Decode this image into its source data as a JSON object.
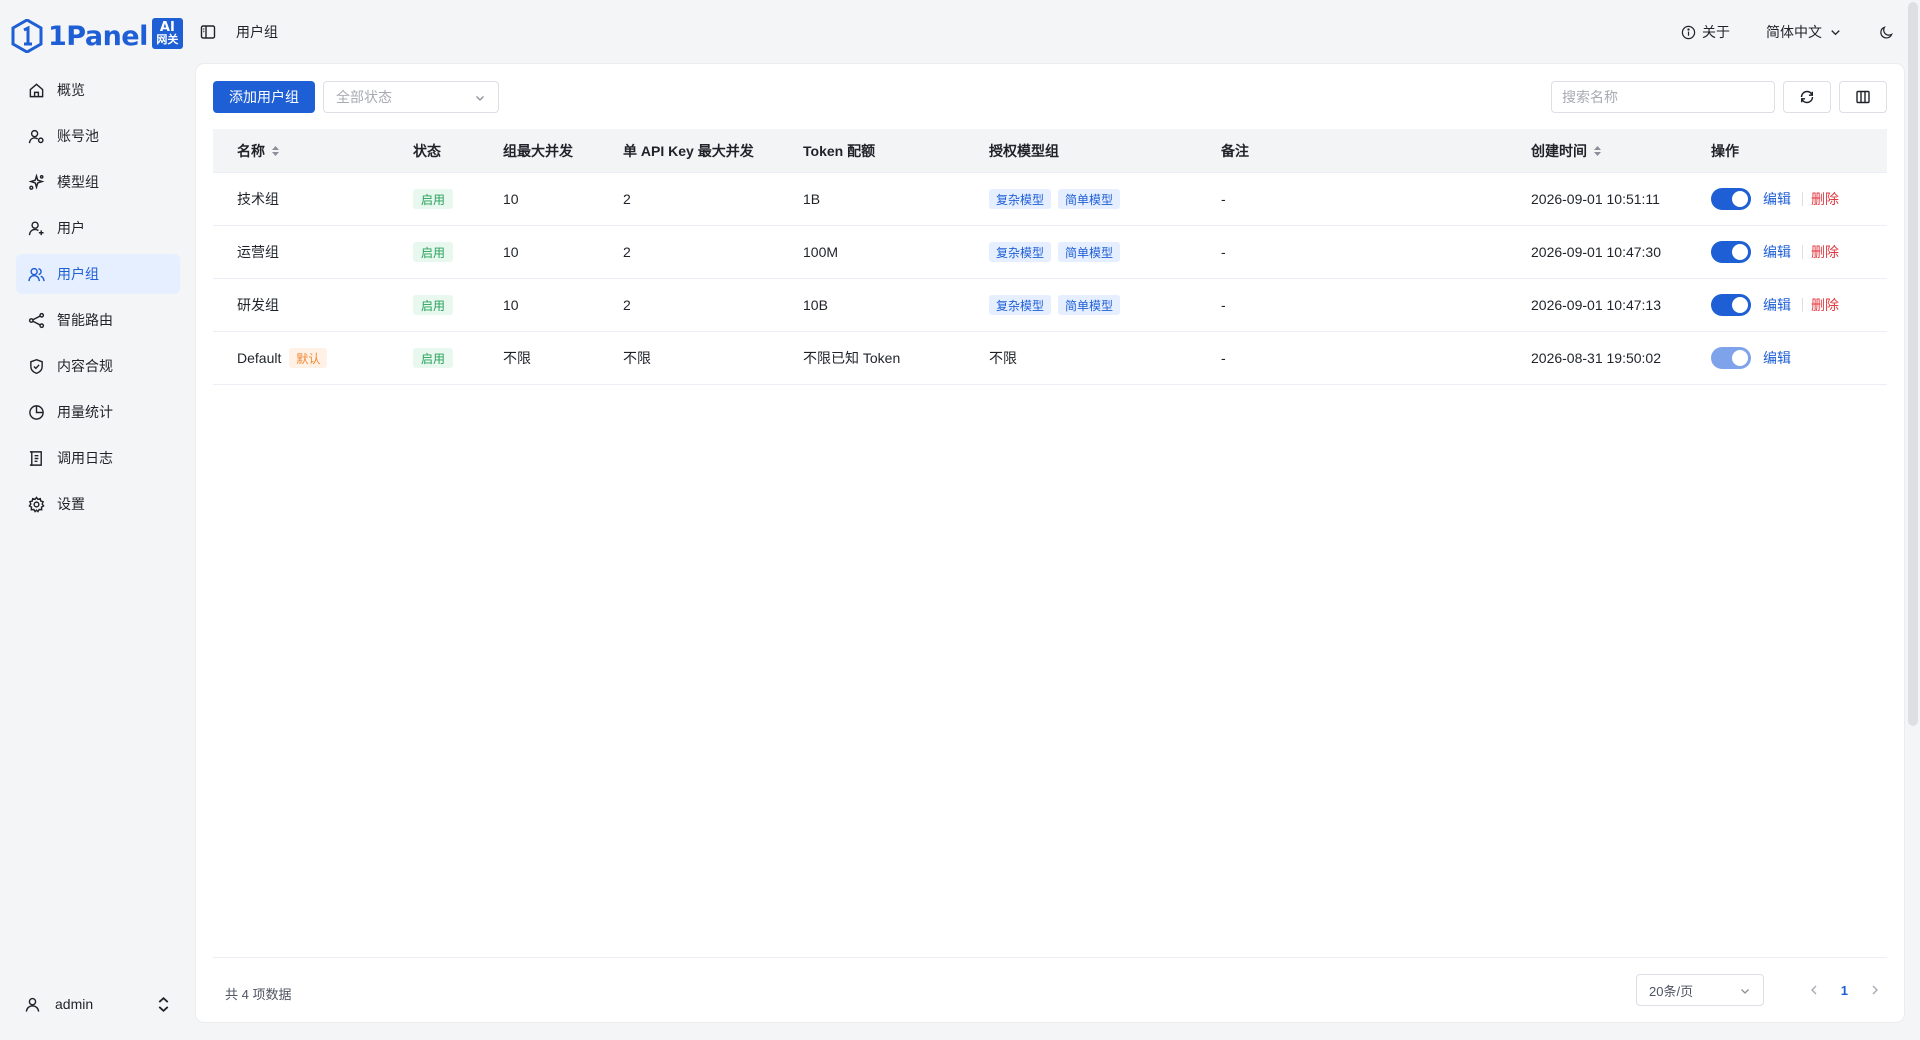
{
  "brand": {
    "name": "1Panel",
    "badge_top": "AI",
    "badge_bottom": "网关"
  },
  "sidebar": {
    "items": [
      {
        "label": "概览",
        "icon": "home-icon",
        "active": false
      },
      {
        "label": "账号池",
        "icon": "account-pool-icon",
        "active": false
      },
      {
        "label": "模型组",
        "icon": "model-group-icon",
        "active": false
      },
      {
        "label": "用户",
        "icon": "user-add-icon",
        "active": false
      },
      {
        "label": "用户组",
        "icon": "users-icon",
        "active": true
      },
      {
        "label": "智能路由",
        "icon": "route-icon",
        "active": false
      },
      {
        "label": "内容合规",
        "icon": "shield-icon",
        "active": false
      },
      {
        "label": "用量统计",
        "icon": "pie-chart-icon",
        "active": false
      },
      {
        "label": "调用日志",
        "icon": "log-icon",
        "active": false
      },
      {
        "label": "设置",
        "icon": "gear-icon",
        "active": false
      }
    ],
    "user": "admin"
  },
  "header": {
    "breadcrumb": "用户组",
    "about": "关于",
    "language": "简体中文"
  },
  "toolbar": {
    "add_label": "添加用户组",
    "status_select": "全部状态",
    "search_placeholder": "搜索名称"
  },
  "table": {
    "columns": [
      "名称",
      "状态",
      "组最大并发",
      "单 API Key 最大并发",
      "Token 配额",
      "授权模型组",
      "备注",
      "创建时间",
      "操作"
    ],
    "rows": [
      {
        "name": "技术组",
        "default_tag": "",
        "status": "启用",
        "max_conc": "10",
        "key_conc": "2",
        "quota": "1B",
        "models": [
          "复杂模型",
          "简单模型"
        ],
        "models_text": "",
        "note": "-",
        "created": "2026-09-01 10:51:11",
        "enabled": true,
        "edit": "编辑",
        "delete": "删除"
      },
      {
        "name": "运营组",
        "default_tag": "",
        "status": "启用",
        "max_conc": "10",
        "key_conc": "2",
        "quota": "100M",
        "models": [
          "复杂模型",
          "简单模型"
        ],
        "models_text": "",
        "note": "-",
        "created": "2026-09-01 10:47:30",
        "enabled": true,
        "edit": "编辑",
        "delete": "删除"
      },
      {
        "name": "研发组",
        "default_tag": "",
        "status": "启用",
        "max_conc": "10",
        "key_conc": "2",
        "quota": "10B",
        "models": [
          "复杂模型",
          "简单模型"
        ],
        "models_text": "",
        "note": "-",
        "created": "2026-09-01 10:47:13",
        "enabled": true,
        "edit": "编辑",
        "delete": "删除"
      },
      {
        "name": "Default",
        "default_tag": "默认",
        "status": "启用",
        "max_conc": "不限",
        "key_conc": "不限",
        "quota": "不限已知 Token",
        "models": [],
        "models_text": "不限",
        "note": "-",
        "created": "2026-08-31 19:50:02",
        "enabled": true,
        "edit": "编辑",
        "delete": ""
      }
    ]
  },
  "footer": {
    "total": "共 4 项数据",
    "page_size": "20条/页",
    "current_page": "1"
  },
  "colors": {
    "primary": "#1f5fd6",
    "success": "#27a15b",
    "danger": "#e0383e",
    "warning": "#f08a35"
  }
}
